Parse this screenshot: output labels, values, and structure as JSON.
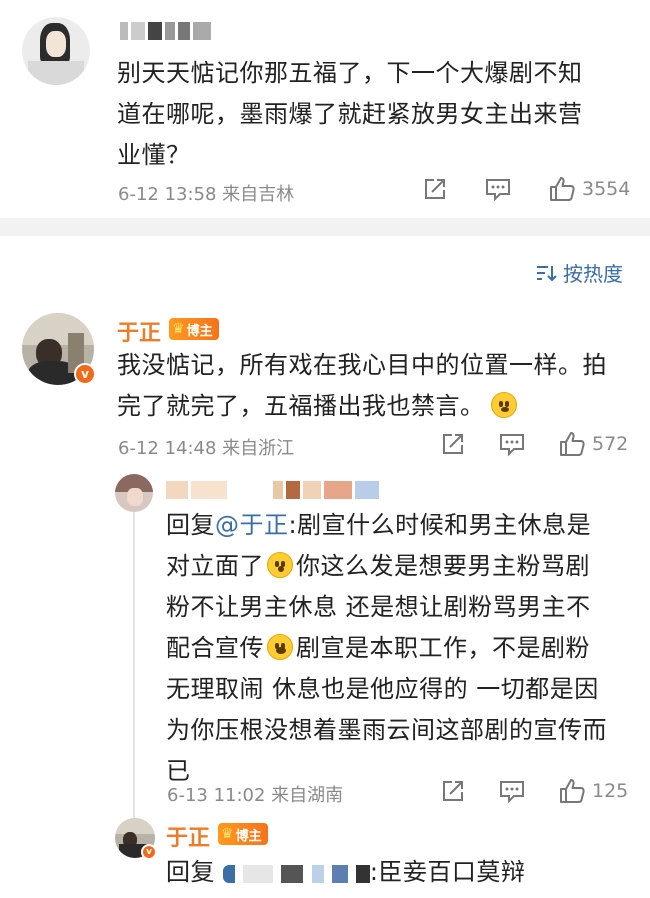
{
  "top_comment": {
    "text_lines": [
      "别天天惦记你那五福了，下一个大爆剧不知",
      "道在哪呢，墨雨爆了就赶紧放男女主出来营",
      "业懂？"
    ],
    "meta": "6-12 13:58  来自吉林",
    "like_count": "3554"
  },
  "sort": {
    "label": "按热度"
  },
  "main_comment": {
    "username": "于正",
    "badge": "博主",
    "text_line1": "我没惦记，所有戏在我心目中的位置一样。拍",
    "text_line2": "完了就完了，五福播出我也禁言。",
    "meta": "6-12 14:48  来自浙江",
    "like_count": "572"
  },
  "reply1": {
    "prefix": "回复",
    "mention": "@于正",
    "lines": [
      ":剧宣什么时候和男主休息是",
      "对立面了",
      "你这么发是想要男主粉骂剧",
      "粉不让男主休息  还是想让剧粉骂男主不",
      "配合宣传",
      "剧宣是本职工作，不是剧粉",
      "无理取闹  休息也是他应得的  一切都是因",
      "为你压根没想着墨雨云间这部剧的宣传而",
      "已"
    ],
    "meta": "6-13 11:02  来自湖南",
    "like_count": "125"
  },
  "reply2": {
    "username": "于正",
    "badge": "博主",
    "prefix": "回复",
    "text": ":臣妾百口莫辩"
  },
  "colors": {
    "link": "#3a6ea5",
    "username": "#ee7b28",
    "meta": "#8a8a8a"
  },
  "icons": {
    "share": "share-icon",
    "comment": "comment-icon",
    "like": "like-icon",
    "sort": "sort-icon",
    "vip": "verified-icon"
  }
}
